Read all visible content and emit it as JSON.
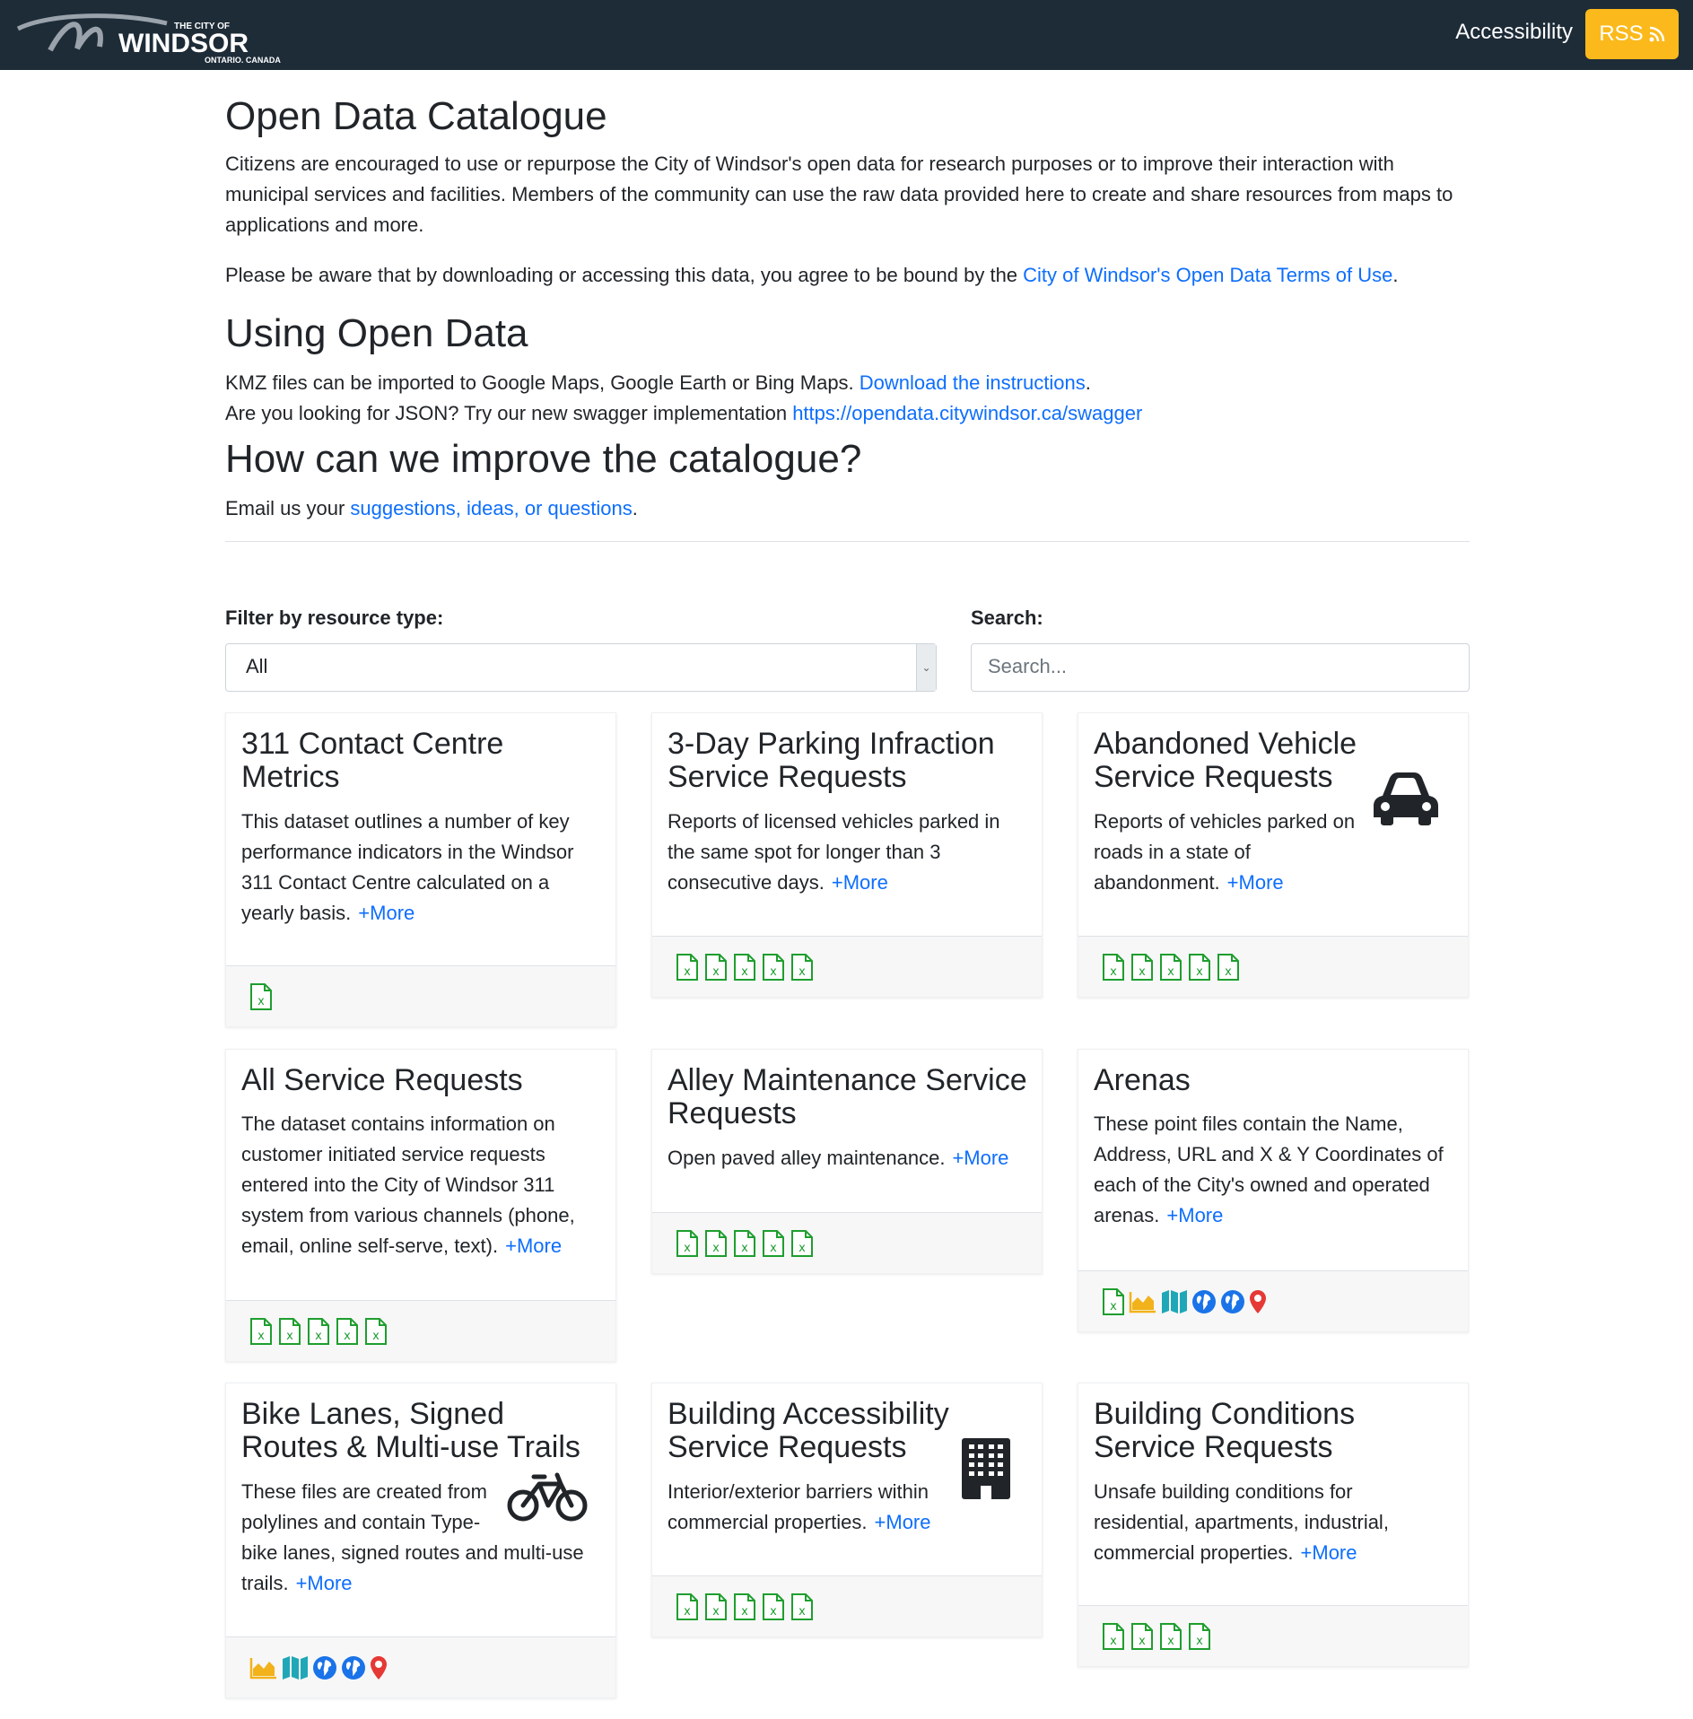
{
  "header": {
    "logo_top": "THE CITY OF",
    "logo_main": "WINDSOR",
    "logo_sub": "ONTARIO, CANADA",
    "accessibility": "Accessibility",
    "rss": "RSS"
  },
  "intro": {
    "title": "Open Data Catalogue",
    "p1": "Citizens are encouraged to use or repurpose the City of Windsor's open data for research purposes or to improve their interaction with municipal services and facilities. Members of the community can use the raw data provided here to create and share resources from maps to applications and more.",
    "p2_pre": "Please be aware that by downloading or accessing this data, you agree to be bound by the ",
    "p2_link": "City of Windsor's Open Data Terms of Use",
    "p2_post": ".",
    "using_title": "Using Open Data",
    "kmz_pre": "KMZ files can be imported to Google Maps, Google Earth or Bing Maps. ",
    "kmz_link": "Download the instructions",
    "kmz_post": ".",
    "json_pre": "Are you looking for JSON? Try our new swagger implementation ",
    "json_link": "https://opendata.citywindsor.ca/swagger",
    "improve_title": "How can we improve the catalogue?",
    "email_pre": "Email us your ",
    "email_link": "suggestions, ideas, or questions",
    "email_post": "."
  },
  "filters": {
    "filter_label": "Filter by resource type:",
    "filter_value": "All",
    "search_label": "Search:",
    "search_placeholder": "Search..."
  },
  "more_label": "+More",
  "cards": [
    {
      "title": "311 Contact Centre Metrics",
      "desc": "This dataset outlines a number of key performance indicators in the Windsor 311 Contact Centre calculated on a yearly basis."
    },
    {
      "title": "3-Day Parking Infraction Service Requests",
      "desc": "Reports of licensed vehicles parked in the same spot for longer than 3 consecutive days."
    },
    {
      "title": "Abandoned Vehicle Service Requests",
      "desc": "Reports of vehicles parked on roads in a state of abandonment."
    },
    {
      "title": "All Service Requests",
      "desc": "The dataset contains information on customer initiated service requests entered into the City of Windsor 311 system from various channels (phone, email, online self-serve, text)."
    },
    {
      "title": "Alley Maintenance Service Requests",
      "desc": "Open paved alley maintenance."
    },
    {
      "title": "Arenas",
      "desc": "These point files contain the Name, Address, URL and X & Y Coordinates of each of the City's owned and operated arenas."
    },
    {
      "title": "Bike Lanes, Signed Routes & Multi-use Trails",
      "desc": "These files are created from polylines and contain Type-bike lanes, signed routes and multi-use trails."
    },
    {
      "title": "Building Accessibility Service Requests",
      "desc": "Interior/exterior barriers within commercial properties."
    },
    {
      "title": "Building Conditions Service Requests",
      "desc": "Unsafe building conditions for residential, apartments, industrial, commercial properties."
    }
  ],
  "icons": {
    "car": "car-icon",
    "bicycle": "bicycle-icon",
    "building": "building-icon",
    "spreadsheet": "spreadsheet-icon",
    "chart": "area-chart-icon",
    "map": "map-icon",
    "globe": "globe-icon",
    "marker": "map-marker-icon"
  },
  "colors": {
    "header_bg": "#1e2c38",
    "rss_bg": "#fbb91b",
    "link": "#0d6efd",
    "spreadsheet": "#1e9e2e",
    "chart": "#f2b21b",
    "map": "#1fa7b8",
    "globe": "#1a73e8",
    "marker": "#e53935"
  }
}
